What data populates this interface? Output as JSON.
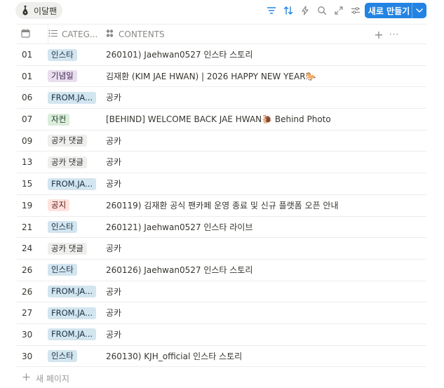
{
  "toolbar": {
    "view_tab_label": "이달팬",
    "new_button_label": "새로 만들기",
    "icon_color": "#2383e2"
  },
  "header": {
    "date_label": "",
    "category_label": "CATEG...",
    "contents_label": "CONTENTS",
    "add_icon": "+",
    "more_icon": "···"
  },
  "tag_colors": {
    "인스타": {
      "bg": "#d3e5ef",
      "fg": "#183347"
    },
    "기념일": {
      "bg": "#e8deee",
      "fg": "#412454"
    },
    "FROM.JA...": {
      "bg": "#d3e5ef",
      "fg": "#183347"
    },
    "자컨": {
      "bg": "#dbeddb",
      "fg": "#1c3829"
    },
    "공카 댓글": {
      "bg": "#eeeeed",
      "fg": "#32302c"
    },
    "공지": {
      "bg": "#ffe2dd",
      "fg": "#5d1715"
    }
  },
  "rows": [
    {
      "date": "01",
      "category": "인스타",
      "contents": "260101) Jaehwan0527 인스타 스토리"
    },
    {
      "date": "01",
      "category": "기념일",
      "contents": "김재환 (KIM JAE HWAN) | 2026 HAPPY NEW YEAR🐎"
    },
    {
      "date": "06",
      "category": "FROM.JA...",
      "contents": "공카"
    },
    {
      "date": "07",
      "category": "자컨",
      "contents": "[BEHIND] WELCOME BACK JAE HWAN🐌 Behind Photo"
    },
    {
      "date": "09",
      "category": "공카 댓글",
      "contents": "공카"
    },
    {
      "date": "13",
      "category": "공카 댓글",
      "contents": "공카"
    },
    {
      "date": "15",
      "category": "FROM.JA...",
      "contents": "공카"
    },
    {
      "date": "19",
      "category": "공지",
      "contents": "260119) 김재환 공식 팬카페 운영 종료 및 신규 플랫폼 오픈 안내"
    },
    {
      "date": "21",
      "category": "인스타",
      "contents": "260121) Jaehwan0527 인스타 라이브"
    },
    {
      "date": "24",
      "category": "공카 댓글",
      "contents": "공카"
    },
    {
      "date": "26",
      "category": "인스타",
      "contents": "260126) Jaehwan0527 인스타 스토리"
    },
    {
      "date": "26",
      "category": "FROM.JA...",
      "contents": "공카"
    },
    {
      "date": "27",
      "category": "FROM.JA...",
      "contents": "공카"
    },
    {
      "date": "30",
      "category": "FROM.JA...",
      "contents": "공카"
    },
    {
      "date": "30",
      "category": "인스타",
      "contents": "260130) KJH_official 인스타 스토리"
    }
  ],
  "footer": {
    "add_page_label": "새 페이지"
  }
}
